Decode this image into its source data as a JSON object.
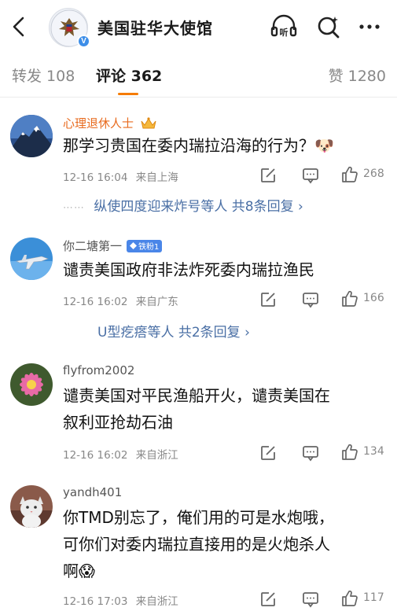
{
  "header": {
    "account_name": "美国驻华大使馆",
    "verified_badge": "V",
    "listen_label": "听"
  },
  "tabs": {
    "repost": "转发 108",
    "comments": "评论 362",
    "likes": "赞 1280"
  },
  "comments": [
    {
      "username": "心理退休人士",
      "text": "那学习贵国在委内瑞拉沿海的行为？🐶",
      "time": "12-16 16:04",
      "location": "来自上海",
      "likes": "268",
      "replies": "纵使四度迎来炸号等人  共8条回复 ›"
    },
    {
      "username": "你二塘第一",
      "badge": "铁粉1",
      "text": "谴责美国政府非法炸死委内瑞拉渔民",
      "time": "12-16 16:02",
      "location": "来自广东",
      "likes": "166",
      "replies": "U型疙瘩等人  共2条回复 ›"
    },
    {
      "username": "flyfrom2002",
      "text_line1": "谴责美国对平民渔船开火，谴责美国在",
      "text_line2": "叙利亚抢劫石油",
      "time": "12-16 16:02",
      "location": "来自浙江",
      "likes": "134"
    },
    {
      "username": "yandh401",
      "text_line1": "你TMD别忘了，俺们用的可是水炮哦，",
      "text_line2": "可你们对委内瑞拉直接用的是火炮杀人",
      "text_line3": "啊😱",
      "time": "12-16 17:03",
      "location": "来自浙江",
      "likes": "117"
    }
  ],
  "colors": {
    "accent": "#f57c00",
    "link": "#4a6fa5",
    "vip_name": "#e86b1f",
    "verified": "#3d8ee8"
  }
}
